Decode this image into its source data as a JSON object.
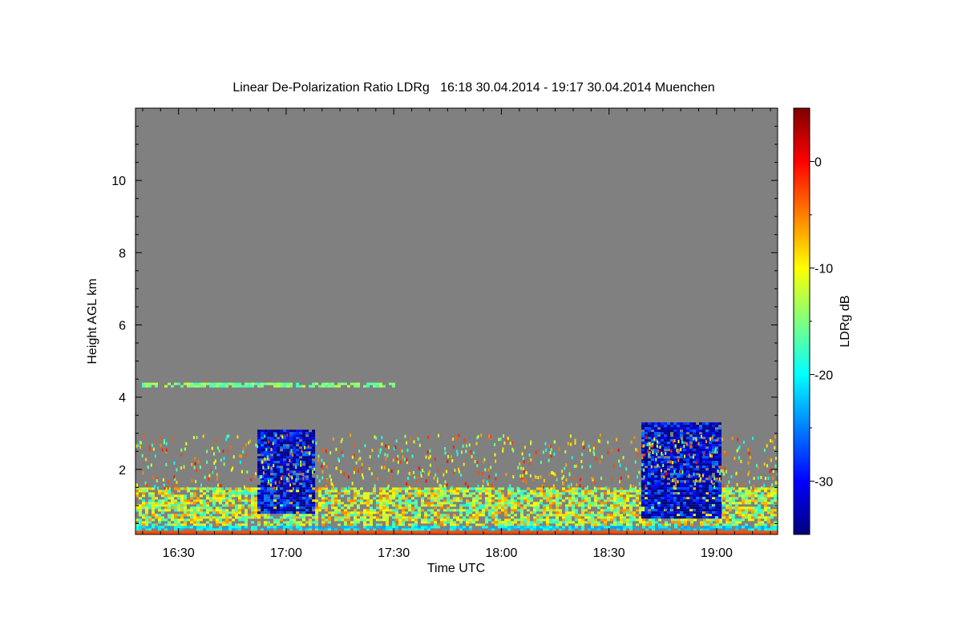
{
  "chart_data": {
    "type": "heatmap",
    "title": "Linear De-Polarization Ratio LDRg   16:18 30.04.2014 - 19:17 30.04.2014 Muenchen",
    "xlabel": "Time UTC",
    "ylabel": "Height AGL km",
    "x_range_minutes_utc": [
      978,
      1157
    ],
    "y_range_km": [
      0.2,
      12.0
    ],
    "x_tick_labels": [
      {
        "label": "16:30",
        "minutes": 990
      },
      {
        "label": "17:00",
        "minutes": 1020
      },
      {
        "label": "17:30",
        "minutes": 1050
      },
      {
        "label": "18:00",
        "minutes": 1080
      },
      {
        "label": "18:30",
        "minutes": 1110
      },
      {
        "label": "19:00",
        "minutes": 1140
      }
    ],
    "y_tick_labels": [
      {
        "label": "2",
        "value": 2
      },
      {
        "label": "4",
        "value": 4
      },
      {
        "label": "6",
        "value": 6
      },
      {
        "label": "8",
        "value": 8
      },
      {
        "label": "10",
        "value": 10
      }
    ],
    "colorbar": {
      "label": "LDRg dB",
      "range_db": [
        -35,
        5
      ],
      "tick_labels": [
        {
          "label": "0",
          "value": 0
        },
        {
          "label": "-10",
          "value": -10
        },
        {
          "label": "-20",
          "value": -20
        },
        {
          "label": "-30",
          "value": -30
        }
      ],
      "colormap": "jet"
    },
    "background_color": "#808080",
    "features": [
      {
        "description": "boundary layer aerosol, mixed LDR",
        "t_start": 978,
        "t_end": 1157,
        "h_bottom": 0.2,
        "h_top": 1.5,
        "ldr_db": -12
      },
      {
        "description": "low depolarization cloud",
        "t_start": 1012,
        "t_end": 1028,
        "h_bottom": 0.8,
        "h_top": 3.1,
        "ldr_db": -32
      },
      {
        "description": "low depolarization cloud",
        "t_start": 1119,
        "t_end": 1141,
        "h_bottom": 0.7,
        "h_top": 3.3,
        "ldr_db": -32
      },
      {
        "description": "thin layer",
        "t_start": 978,
        "t_end": 1050,
        "h_bottom": 4.3,
        "h_top": 4.4,
        "ldr_db": -6
      }
    ]
  }
}
